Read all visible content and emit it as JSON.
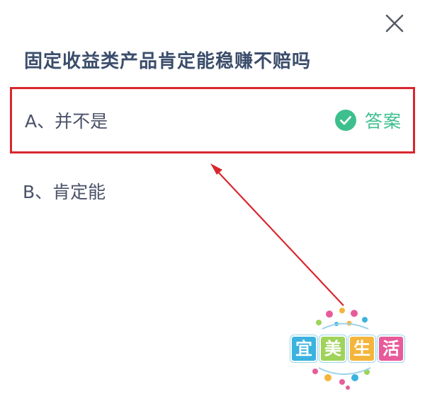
{
  "question": {
    "title": "固定收益类产品肯定能稳赚不赔吗"
  },
  "options": [
    {
      "label": "A、并不是",
      "is_answer": true,
      "highlighted": true
    },
    {
      "label": "B、肯定能",
      "is_answer": false,
      "highlighted": false
    }
  ],
  "answer_badge": {
    "text": "答案",
    "icon": "check-circle-icon",
    "color": "#3dbf8e"
  },
  "close": {
    "icon": "close-icon"
  },
  "annotation": {
    "highlight_color": "#d9262e"
  },
  "watermark": {
    "chars": [
      "宜",
      "美",
      "生",
      "活"
    ],
    "tile_colors": [
      "#3ab3e0",
      "#9fd35a",
      "#f5b53a",
      "#e85b9a"
    ]
  },
  "colors": {
    "question_text": "#3b4d6b",
    "option_text": "#4a5268"
  }
}
